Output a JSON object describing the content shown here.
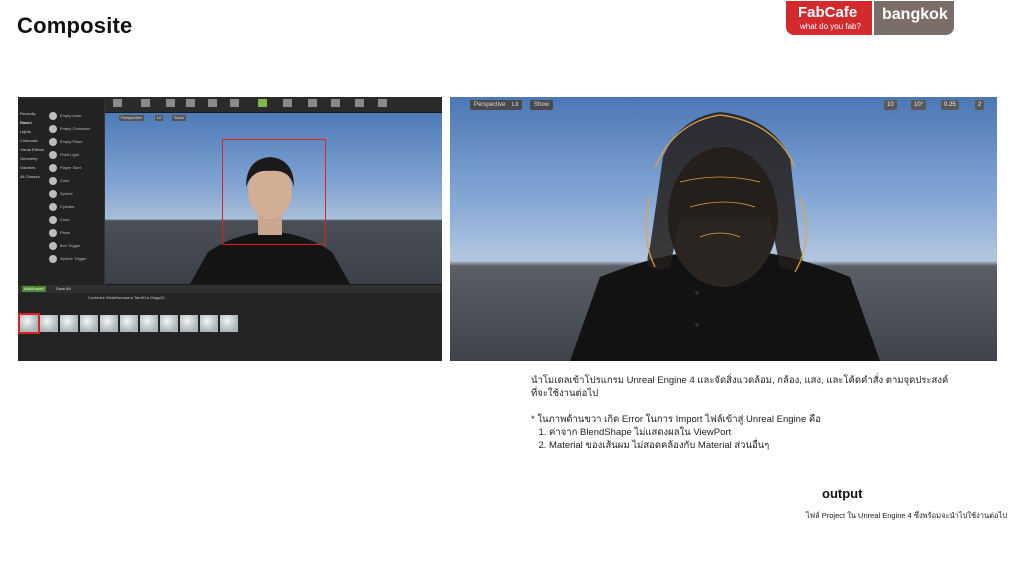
{
  "slide": {
    "title": "Composite"
  },
  "logo": {
    "brand": "FabCafe",
    "tagline": "what do you fab?",
    "city": "bangkok",
    "red": "#d32a2e",
    "grey": "#7b6e69"
  },
  "left_screenshot": {
    "mode_categories": [
      "Recently Placed",
      "Basic",
      "Lights",
      "Cinematic",
      "Visual Effects",
      "Geometry",
      "Volumes",
      "All Classes"
    ],
    "mode_items": [
      "Empty Actor",
      "Empty Character",
      "Empty Pawn",
      "Point Light",
      "Player Start",
      "Cube",
      "Sphere",
      "Cylinder",
      "Cone",
      "Plane",
      "Box Trigger",
      "Sphere Trigger"
    ],
    "viewport_chips": [
      "Perspective",
      "Lit",
      "Show"
    ],
    "content_path": "Content ▸ MetaHumans ▸ Tam01 ▸ Mugs01",
    "content_buttons": [
      "Add/Import",
      "Save All"
    ],
    "asset_count": 11
  },
  "right_screenshot": {
    "viewport_chips": [
      "Perspective",
      "Lit",
      "Show"
    ],
    "grid_snap": "10",
    "rotation_snap": "10°",
    "scale_snap": "0.25",
    "camera_speed": "2"
  },
  "notes": {
    "line1": "นำโมเดลเข้าโปรแกรม Unreal Engine 4 และจัดสิ่งแวดล้อม, กล้อง, แสง, และโค้ดคำสั่ง ตามจุดประสงค์ที่จะใช้งานต่อไป",
    "line2": "* ในภาพด้านขวา เกิด Error ในการ Import ไฟล์เข้าสู่ Unreal Engine คือ",
    "items": [
      "ค่าจาก BlendShape ไม่แสดงผลใน ViewPort",
      "Material ของเส้นผม ไม่สอดคล้องกับ Material ส่วนอื่นๆ"
    ]
  },
  "output": {
    "heading": "output",
    "description": "ไฟล์ Project ใน Unreal Engine 4 ซึ่งพร้อมจะนำไปใช้งานต่อไป"
  }
}
